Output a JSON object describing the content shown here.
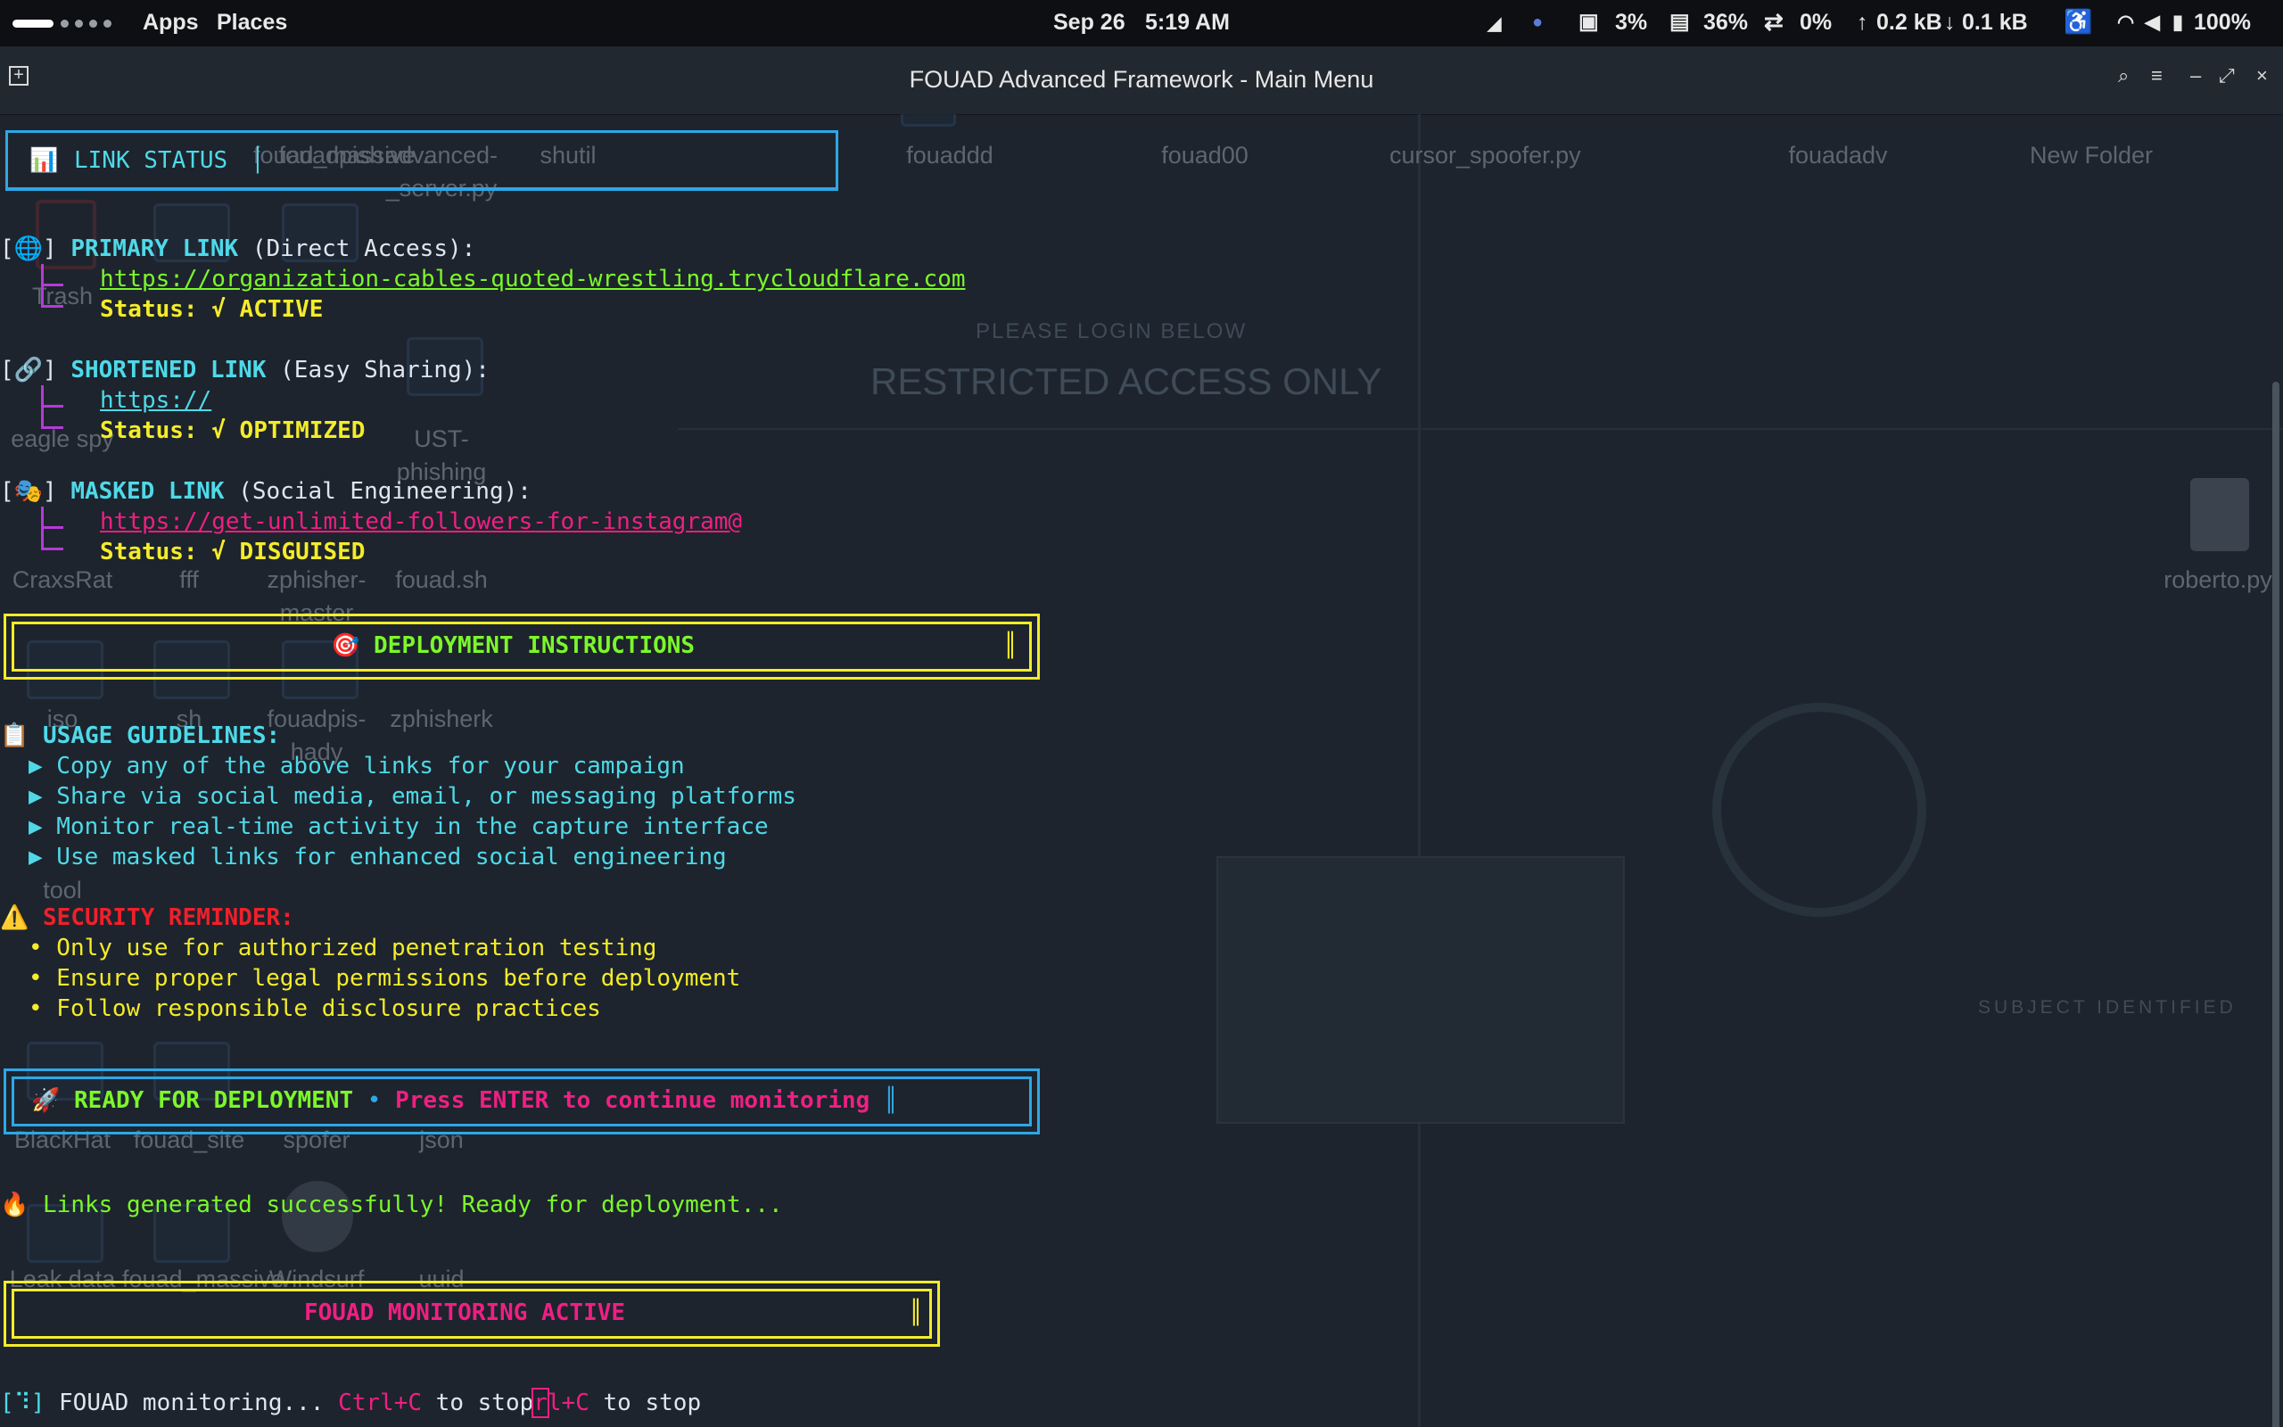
{
  "topbar": {
    "apps": "Apps",
    "places": "Places",
    "date": "Sep 26",
    "time": "5:19 AM",
    "cpu": "3%",
    "mem": "36%",
    "swap": "0%",
    "net_up": "0.2 kB",
    "net_down": "0.1 kB",
    "battery": "100%"
  },
  "window": {
    "title": "FOUAD Advanced Framework - Main Menu"
  },
  "desktop": {
    "icons": [
      "Trash",
      "fouadpish",
      "fouad_massive...",
      "advanced-_server.py",
      "shutil",
      "fouaddd",
      "fouad00",
      "cursor_spoofer.py",
      "fouadadv",
      "New Folder",
      "eagle spy",
      "UST-phishing",
      "CraxsRat",
      "fff",
      "zphisher-master",
      "fouad.sh",
      "roberto.py",
      "iso",
      "sh",
      "fouadpis-hady",
      "zphisherk",
      "tool",
      "BlackHat",
      "fouad_site",
      "spofer",
      "json",
      "Leak data",
      "fouad_massive",
      "Windsurf",
      "uuid"
    ],
    "wallpaper_text": {
      "please_login": "PLEASE LOGIN BELOW",
      "restricted": "RESTRICTED ACCESS ONLY",
      "subject": "SUBJECT IDENTIFIED"
    }
  },
  "terminal": {
    "link_status_header": "LINK STATUS",
    "primary": {
      "icon": "🌐",
      "title": "PRIMARY LINK",
      "subtitle": "(Direct Access):",
      "url": "https://organization-cables-quoted-wrestling.trycloudflare.com",
      "status_label": "Status:",
      "status_value": "√ ACTIVE"
    },
    "shortened": {
      "icon": "🔗",
      "title": "SHORTENED LINK",
      "subtitle": "(Easy Sharing):",
      "url": "https://",
      "status_label": "Status:",
      "status_value": "√ OPTIMIZED"
    },
    "masked": {
      "icon": "🎭",
      "title": "MASKED LINK",
      "subtitle": "(Social Engineering):",
      "url": "https://get-unlimited-followers-for-instagram@",
      "status_label": "Status:",
      "status_value": "√ DISGUISED"
    },
    "deployment_header": "🎯 DEPLOYMENT INSTRUCTIONS",
    "usage_title": "📋 USAGE GUIDELINES:",
    "usage_items": [
      "▶ Copy any of the above links for your campaign",
      "▶ Share via social media, email, or messaging platforms",
      "▶ Monitor real-time activity in the capture interface",
      "▶ Use masked links for enhanced social engineering"
    ],
    "security_icon": "⚠️",
    "security_title": "SECURITY REMINDER:",
    "security_items": [
      "• Only use for authorized penetration testing",
      "• Ensure proper legal permissions before deployment",
      "• Follow responsible disclosure practices"
    ],
    "ready_icon": "🚀",
    "ready_text": "READY FOR DEPLOYMENT",
    "ready_sep": "•",
    "ready_prompt": "Press ENTER to continue monitoring",
    "success_icon": "🔥",
    "success_text": "Links generated successfully! Ready for deployment...",
    "monitoring_header": "FOUAD MONITORING ACTIVE",
    "spinner": "[⠹]",
    "monitoring_text": "FOUAD monitoring...",
    "ctrl_c": "Ctrl+C",
    "to_stop": "to stop",
    "tail_r": "r",
    "tail_rest": "l+C",
    "tail_to_stop": "to stop"
  },
  "colors": {
    "cyan": "#4fd9e8",
    "green": "#7cf72a",
    "yellow": "#f4ec2a",
    "magenta": "#ef1f83",
    "red": "#f0202b",
    "purple": "#b43bd8",
    "blue_border": "#2ea7e6"
  }
}
